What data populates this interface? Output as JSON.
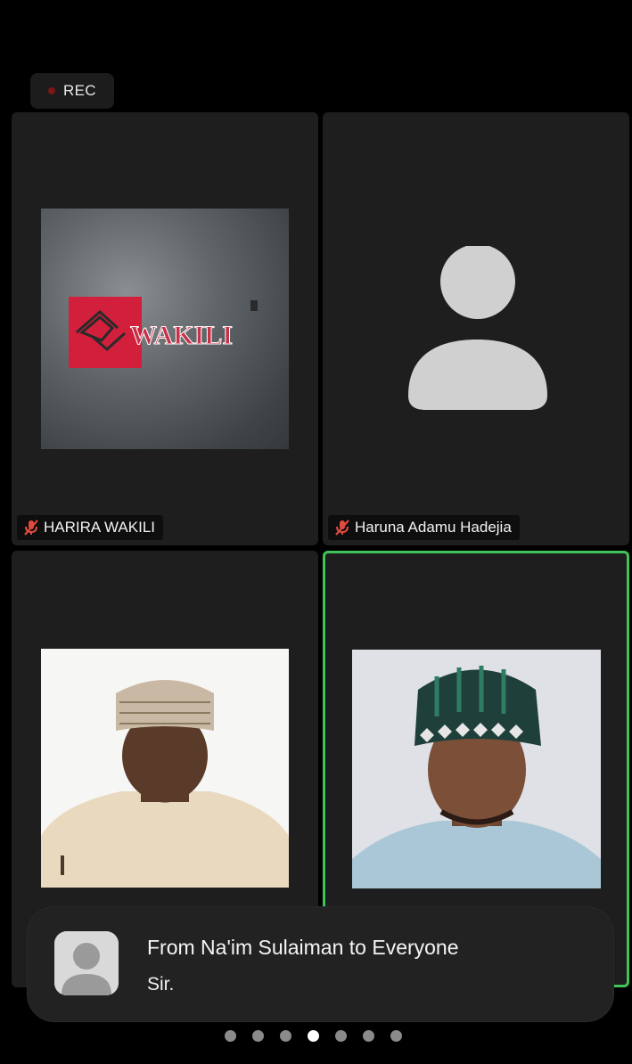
{
  "recording": {
    "label": "REC"
  },
  "participants": [
    {
      "name": "HARIRA WAKILI",
      "muted": true,
      "photo": "wakili-logo"
    },
    {
      "name": "Haruna Adamu Hadejia",
      "muted": true,
      "photo": "generic-avatar"
    },
    {
      "name": "",
      "muted": true,
      "photo": "participant-photo"
    },
    {
      "name": "",
      "muted": false,
      "photo": "participant-photo",
      "active_speaker": true
    }
  ],
  "logo": {
    "text": "WAKILI",
    "superscript": ""
  },
  "notification": {
    "title": "From Na'im Sulaiman to Everyone",
    "message": "Sir."
  },
  "pagination": {
    "total": 7,
    "current": 4
  },
  "colors": {
    "active_speaker_border": "#3fc45a",
    "logo_red": "#d21f3c",
    "muted_icon": "#e04b3f"
  }
}
